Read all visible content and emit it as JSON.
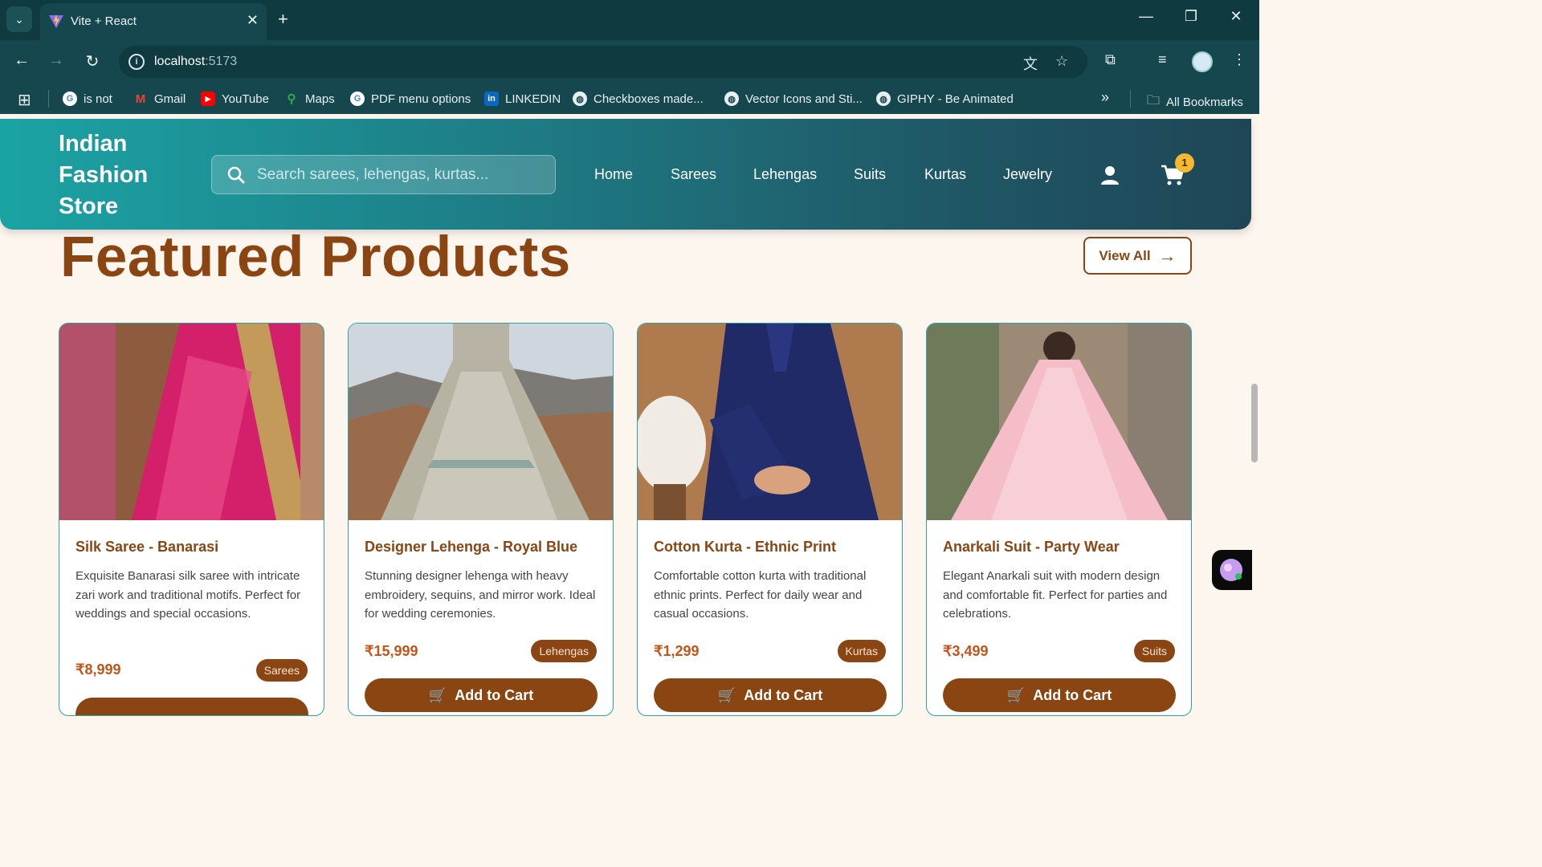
{
  "browser": {
    "tab_title": "Vite + React",
    "url_host": "localhost",
    "url_port": ":5173",
    "bookmarks": [
      {
        "label": "is not",
        "icon": "google-icon"
      },
      {
        "label": "Gmail",
        "icon": "gmail-icon"
      },
      {
        "label": "YouTube",
        "icon": "youtube-icon"
      },
      {
        "label": "Maps",
        "icon": "maps-icon"
      },
      {
        "label": "PDF menu options",
        "icon": "google-icon"
      },
      {
        "label": "LINKEDIN",
        "icon": "linkedin-icon"
      },
      {
        "label": "Checkboxes made...",
        "icon": "globe-icon"
      },
      {
        "label": "Vector Icons and Sti...",
        "icon": "globe-icon"
      },
      {
        "label": "GIPHY - Be Animated",
        "icon": "globe-icon"
      }
    ],
    "all_bookmarks": "All Bookmarks"
  },
  "header": {
    "logo_line1": "Indian",
    "logo_line2": "Fashion",
    "logo_line3": "Store",
    "search_placeholder": "Search sarees, lehengas, kurtas...",
    "nav": [
      "Home",
      "Sarees",
      "Lehengas",
      "Suits",
      "Kurtas",
      "Jewelry"
    ],
    "cart_count": "1"
  },
  "featured": {
    "title": "Featured Products",
    "view_all": "View All",
    "products": [
      {
        "name": "Silk Saree - Banarasi",
        "description": "Exquisite Banarasi silk saree with intricate zari work and traditional motifs. Perfect for weddings and special occasions.",
        "price": "₹8,999",
        "category": "Sarees"
      },
      {
        "name": "Designer Lehenga - Royal Blue",
        "description": "Stunning designer lehenga with heavy embroidery, sequins, and mirror work. Ideal for wedding ceremonies.",
        "price": "₹15,999",
        "category": "Lehengas",
        "button": "Add to Cart"
      },
      {
        "name": "Cotton Kurta - Ethnic Print",
        "description": "Comfortable cotton kurta with traditional ethnic prints. Perfect for daily wear and casual occasions.",
        "price": "₹1,299",
        "category": "Kurtas",
        "button": "Add to Cart"
      },
      {
        "name": "Anarkali Suit - Party Wear",
        "description": "Elegant Anarkali suit with modern design and comfortable fit. Perfect for parties and celebrations.",
        "price": "₹3,499",
        "category": "Suits",
        "button": "Add to Cart"
      }
    ]
  },
  "colors": {
    "brand_brown": "#8b4513",
    "price": "#c4541a",
    "header_teal": "#1ba3a4",
    "badge_yellow": "#f5b82e"
  }
}
